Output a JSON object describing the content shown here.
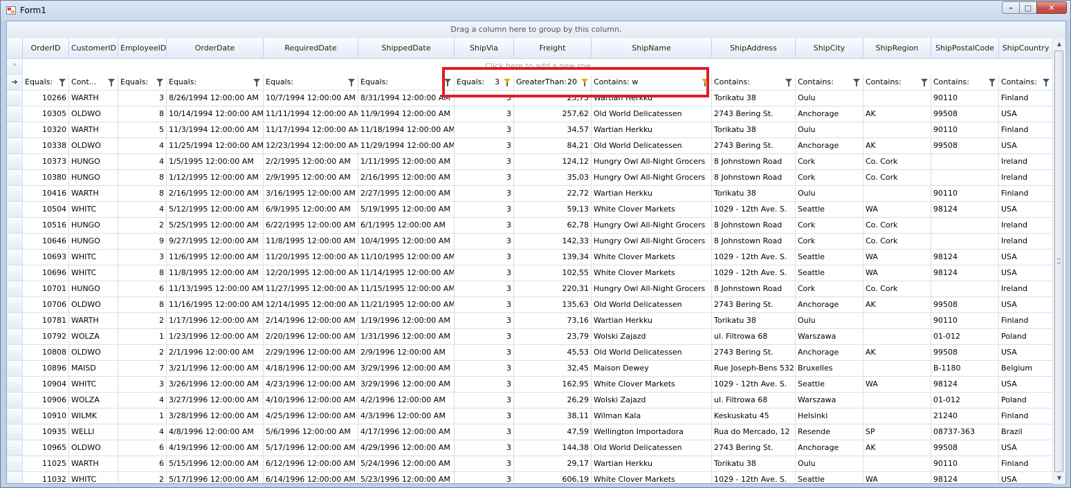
{
  "window": {
    "title": "Form1",
    "min": "–",
    "max": "□",
    "close": "✕"
  },
  "group_panel": "Drag a column here to group by this column.",
  "new_row": {
    "marker": "*",
    "text": "Click here to add a new row"
  },
  "current_row_marker": "➔",
  "columns": [
    "OrderID",
    "CustomerID",
    "EmployeeID",
    "OrderDate",
    "RequiredDate",
    "ShippedDate",
    "ShipVia",
    "Freight",
    "ShipName",
    "ShipAddress",
    "ShipCity",
    "ShipRegion",
    "ShipPostalCode",
    "ShipCountry"
  ],
  "filters": [
    {
      "op": "Equals:",
      "value": "",
      "active": false
    },
    {
      "op": "Cont...",
      "value": "",
      "active": false
    },
    {
      "op": "Equals:",
      "value": "",
      "active": false
    },
    {
      "op": "Equals:",
      "value": "",
      "active": false
    },
    {
      "op": "Equals:",
      "value": "",
      "active": false
    },
    {
      "op": "Equals:",
      "value": "",
      "active": false
    },
    {
      "op": "Equals:",
      "value": "3",
      "active": true
    },
    {
      "op": "GreaterThan:",
      "value": "20",
      "active": true
    },
    {
      "op": "Contains: w",
      "value": "",
      "active": true
    },
    {
      "op": "Contains:",
      "value": "",
      "active": false
    },
    {
      "op": "Contains:",
      "value": "",
      "active": false
    },
    {
      "op": "Contains:",
      "value": "",
      "active": false
    },
    {
      "op": "Contains:",
      "value": "",
      "active": false
    },
    {
      "op": "Contains:",
      "value": "",
      "active": false
    }
  ],
  "rows": [
    [
      "10266",
      "WARTH",
      "3",
      "8/26/1994 12:00:00 AM",
      "10/7/1994 12:00:00 AM",
      "8/31/1994 12:00:00 AM",
      "3",
      "25,73",
      "Wartian Herkku",
      "Torikatu 38",
      "Oulu",
      "",
      "90110",
      "Finland"
    ],
    [
      "10305",
      "OLDWO",
      "8",
      "10/14/1994 12:00:00 AM",
      "11/11/1994 12:00:00 AM",
      "11/9/1994 12:00:00 AM",
      "3",
      "257,62",
      "Old World Delicatessen",
      "2743 Bering St.",
      "Anchorage",
      "AK",
      "99508",
      "USA"
    ],
    [
      "10320",
      "WARTH",
      "5",
      "11/3/1994 12:00:00 AM",
      "11/17/1994 12:00:00 AM",
      "11/18/1994 12:00:00 AM",
      "3",
      "34,57",
      "Wartian Herkku",
      "Torikatu 38",
      "Oulu",
      "",
      "90110",
      "Finland"
    ],
    [
      "10338",
      "OLDWO",
      "4",
      "11/25/1994 12:00:00 AM",
      "12/23/1994 12:00:00 AM",
      "11/29/1994 12:00:00 AM",
      "3",
      "84,21",
      "Old World Delicatessen",
      "2743 Bering St.",
      "Anchorage",
      "AK",
      "99508",
      "USA"
    ],
    [
      "10373",
      "HUNGO",
      "4",
      "1/5/1995 12:00:00 AM",
      "2/2/1995 12:00:00 AM",
      "1/11/1995 12:00:00 AM",
      "3",
      "124,12",
      "Hungry Owl All-Night Grocers",
      "8 Johnstown Road",
      "Cork",
      "Co. Cork",
      "",
      "Ireland"
    ],
    [
      "10380",
      "HUNGO",
      "8",
      "1/12/1995 12:00:00 AM",
      "2/9/1995 12:00:00 AM",
      "2/16/1995 12:00:00 AM",
      "3",
      "35,03",
      "Hungry Owl All-Night Grocers",
      "8 Johnstown Road",
      "Cork",
      "Co. Cork",
      "",
      "Ireland"
    ],
    [
      "10416",
      "WARTH",
      "8",
      "2/16/1995 12:00:00 AM",
      "3/16/1995 12:00:00 AM",
      "2/27/1995 12:00:00 AM",
      "3",
      "22,72",
      "Wartian Herkku",
      "Torikatu 38",
      "Oulu",
      "",
      "90110",
      "Finland"
    ],
    [
      "10504",
      "WHITC",
      "4",
      "5/12/1995 12:00:00 AM",
      "6/9/1995 12:00:00 AM",
      "5/19/1995 12:00:00 AM",
      "3",
      "59,13",
      "White Clover Markets",
      "1029 - 12th Ave. S.",
      "Seattle",
      "WA",
      "98124",
      "USA"
    ],
    [
      "10516",
      "HUNGO",
      "2",
      "5/25/1995 12:00:00 AM",
      "6/22/1995 12:00:00 AM",
      "6/1/1995 12:00:00 AM",
      "3",
      "62,78",
      "Hungry Owl All-Night Grocers",
      "8 Johnstown Road",
      "Cork",
      "Co. Cork",
      "",
      "Ireland"
    ],
    [
      "10646",
      "HUNGO",
      "9",
      "9/27/1995 12:00:00 AM",
      "11/8/1995 12:00:00 AM",
      "10/4/1995 12:00:00 AM",
      "3",
      "142,33",
      "Hungry Owl All-Night Grocers",
      "8 Johnstown Road",
      "Cork",
      "Co. Cork",
      "",
      "Ireland"
    ],
    [
      "10693",
      "WHITC",
      "3",
      "11/6/1995 12:00:00 AM",
      "11/20/1995 12:00:00 AM",
      "11/10/1995 12:00:00 AM",
      "3",
      "139,34",
      "White Clover Markets",
      "1029 - 12th Ave. S.",
      "Seattle",
      "WA",
      "98124",
      "USA"
    ],
    [
      "10696",
      "WHITC",
      "8",
      "11/8/1995 12:00:00 AM",
      "12/20/1995 12:00:00 AM",
      "11/14/1995 12:00:00 AM",
      "3",
      "102,55",
      "White Clover Markets",
      "1029 - 12th Ave. S.",
      "Seattle",
      "WA",
      "98124",
      "USA"
    ],
    [
      "10701",
      "HUNGO",
      "6",
      "11/13/1995 12:00:00 AM",
      "11/27/1995 12:00:00 AM",
      "11/15/1995 12:00:00 AM",
      "3",
      "220,31",
      "Hungry Owl All-Night Grocers",
      "8 Johnstown Road",
      "Cork",
      "Co. Cork",
      "",
      "Ireland"
    ],
    [
      "10706",
      "OLDWO",
      "8",
      "11/16/1995 12:00:00 AM",
      "12/14/1995 12:00:00 AM",
      "11/21/1995 12:00:00 AM",
      "3",
      "135,63",
      "Old World Delicatessen",
      "2743 Bering St.",
      "Anchorage",
      "AK",
      "99508",
      "USA"
    ],
    [
      "10781",
      "WARTH",
      "2",
      "1/17/1996 12:00:00 AM",
      "2/14/1996 12:00:00 AM",
      "1/19/1996 12:00:00 AM",
      "3",
      "73,16",
      "Wartian Herkku",
      "Torikatu 38",
      "Oulu",
      "",
      "90110",
      "Finland"
    ],
    [
      "10792",
      "WOLZA",
      "1",
      "1/23/1996 12:00:00 AM",
      "2/20/1996 12:00:00 AM",
      "1/31/1996 12:00:00 AM",
      "3",
      "23,79",
      "Wolski Zajazd",
      "ul. Filtrowa 68",
      "Warszawa",
      "",
      "01-012",
      "Poland"
    ],
    [
      "10808",
      "OLDWO",
      "2",
      "2/1/1996 12:00:00 AM",
      "2/29/1996 12:00:00 AM",
      "2/9/1996 12:00:00 AM",
      "3",
      "45,53",
      "Old World Delicatessen",
      "2743 Bering St.",
      "Anchorage",
      "AK",
      "99508",
      "USA"
    ],
    [
      "10896",
      "MAISD",
      "7",
      "3/21/1996 12:00:00 AM",
      "4/18/1996 12:00:00 AM",
      "3/29/1996 12:00:00 AM",
      "3",
      "32,45",
      "Maison Dewey",
      "Rue Joseph-Bens 532",
      "Bruxelles",
      "",
      "B-1180",
      "Belgium"
    ],
    [
      "10904",
      "WHITC",
      "3",
      "3/26/1996 12:00:00 AM",
      "4/23/1996 12:00:00 AM",
      "3/29/1996 12:00:00 AM",
      "3",
      "162,95",
      "White Clover Markets",
      "1029 - 12th Ave. S.",
      "Seattle",
      "WA",
      "98124",
      "USA"
    ],
    [
      "10906",
      "WOLZA",
      "4",
      "3/27/1996 12:00:00 AM",
      "4/10/1996 12:00:00 AM",
      "4/2/1996 12:00:00 AM",
      "3",
      "26,29",
      "Wolski Zajazd",
      "ul. Filtrowa 68",
      "Warszawa",
      "",
      "01-012",
      "Poland"
    ],
    [
      "10910",
      "WILMK",
      "1",
      "3/28/1996 12:00:00 AM",
      "4/25/1996 12:00:00 AM",
      "4/3/1996 12:00:00 AM",
      "3",
      "38,11",
      "Wilman Kala",
      "Keskuskatu 45",
      "Helsinki",
      "",
      "21240",
      "Finland"
    ],
    [
      "10935",
      "WELLI",
      "4",
      "4/8/1996 12:00:00 AM",
      "5/6/1996 12:00:00 AM",
      "4/17/1996 12:00:00 AM",
      "3",
      "47,59",
      "Wellington Importadora",
      "Rua do Mercado, 12",
      "Resende",
      "SP",
      "08737-363",
      "Brazil"
    ],
    [
      "10965",
      "OLDWO",
      "6",
      "4/19/1996 12:00:00 AM",
      "5/17/1996 12:00:00 AM",
      "4/29/1996 12:00:00 AM",
      "3",
      "144,38",
      "Old World Delicatessen",
      "2743 Bering St.",
      "Anchorage",
      "AK",
      "99508",
      "USA"
    ],
    [
      "11025",
      "WARTH",
      "6",
      "5/15/1996 12:00:00 AM",
      "6/12/1996 12:00:00 AM",
      "5/24/1996 12:00:00 AM",
      "3",
      "29,17",
      "Wartian Herkku",
      "Torikatu 38",
      "Oulu",
      "",
      "90110",
      "Finland"
    ],
    [
      "11032",
      "WHITC",
      "2",
      "5/17/1996 12:00:00 AM",
      "6/14/1996 12:00:00 AM",
      "5/23/1996 12:00:00 AM",
      "3",
      "606,19",
      "White Clover Markets",
      "1029 - 12th Ave. S.",
      "Seattle",
      "WA",
      "98124",
      "USA"
    ]
  ]
}
